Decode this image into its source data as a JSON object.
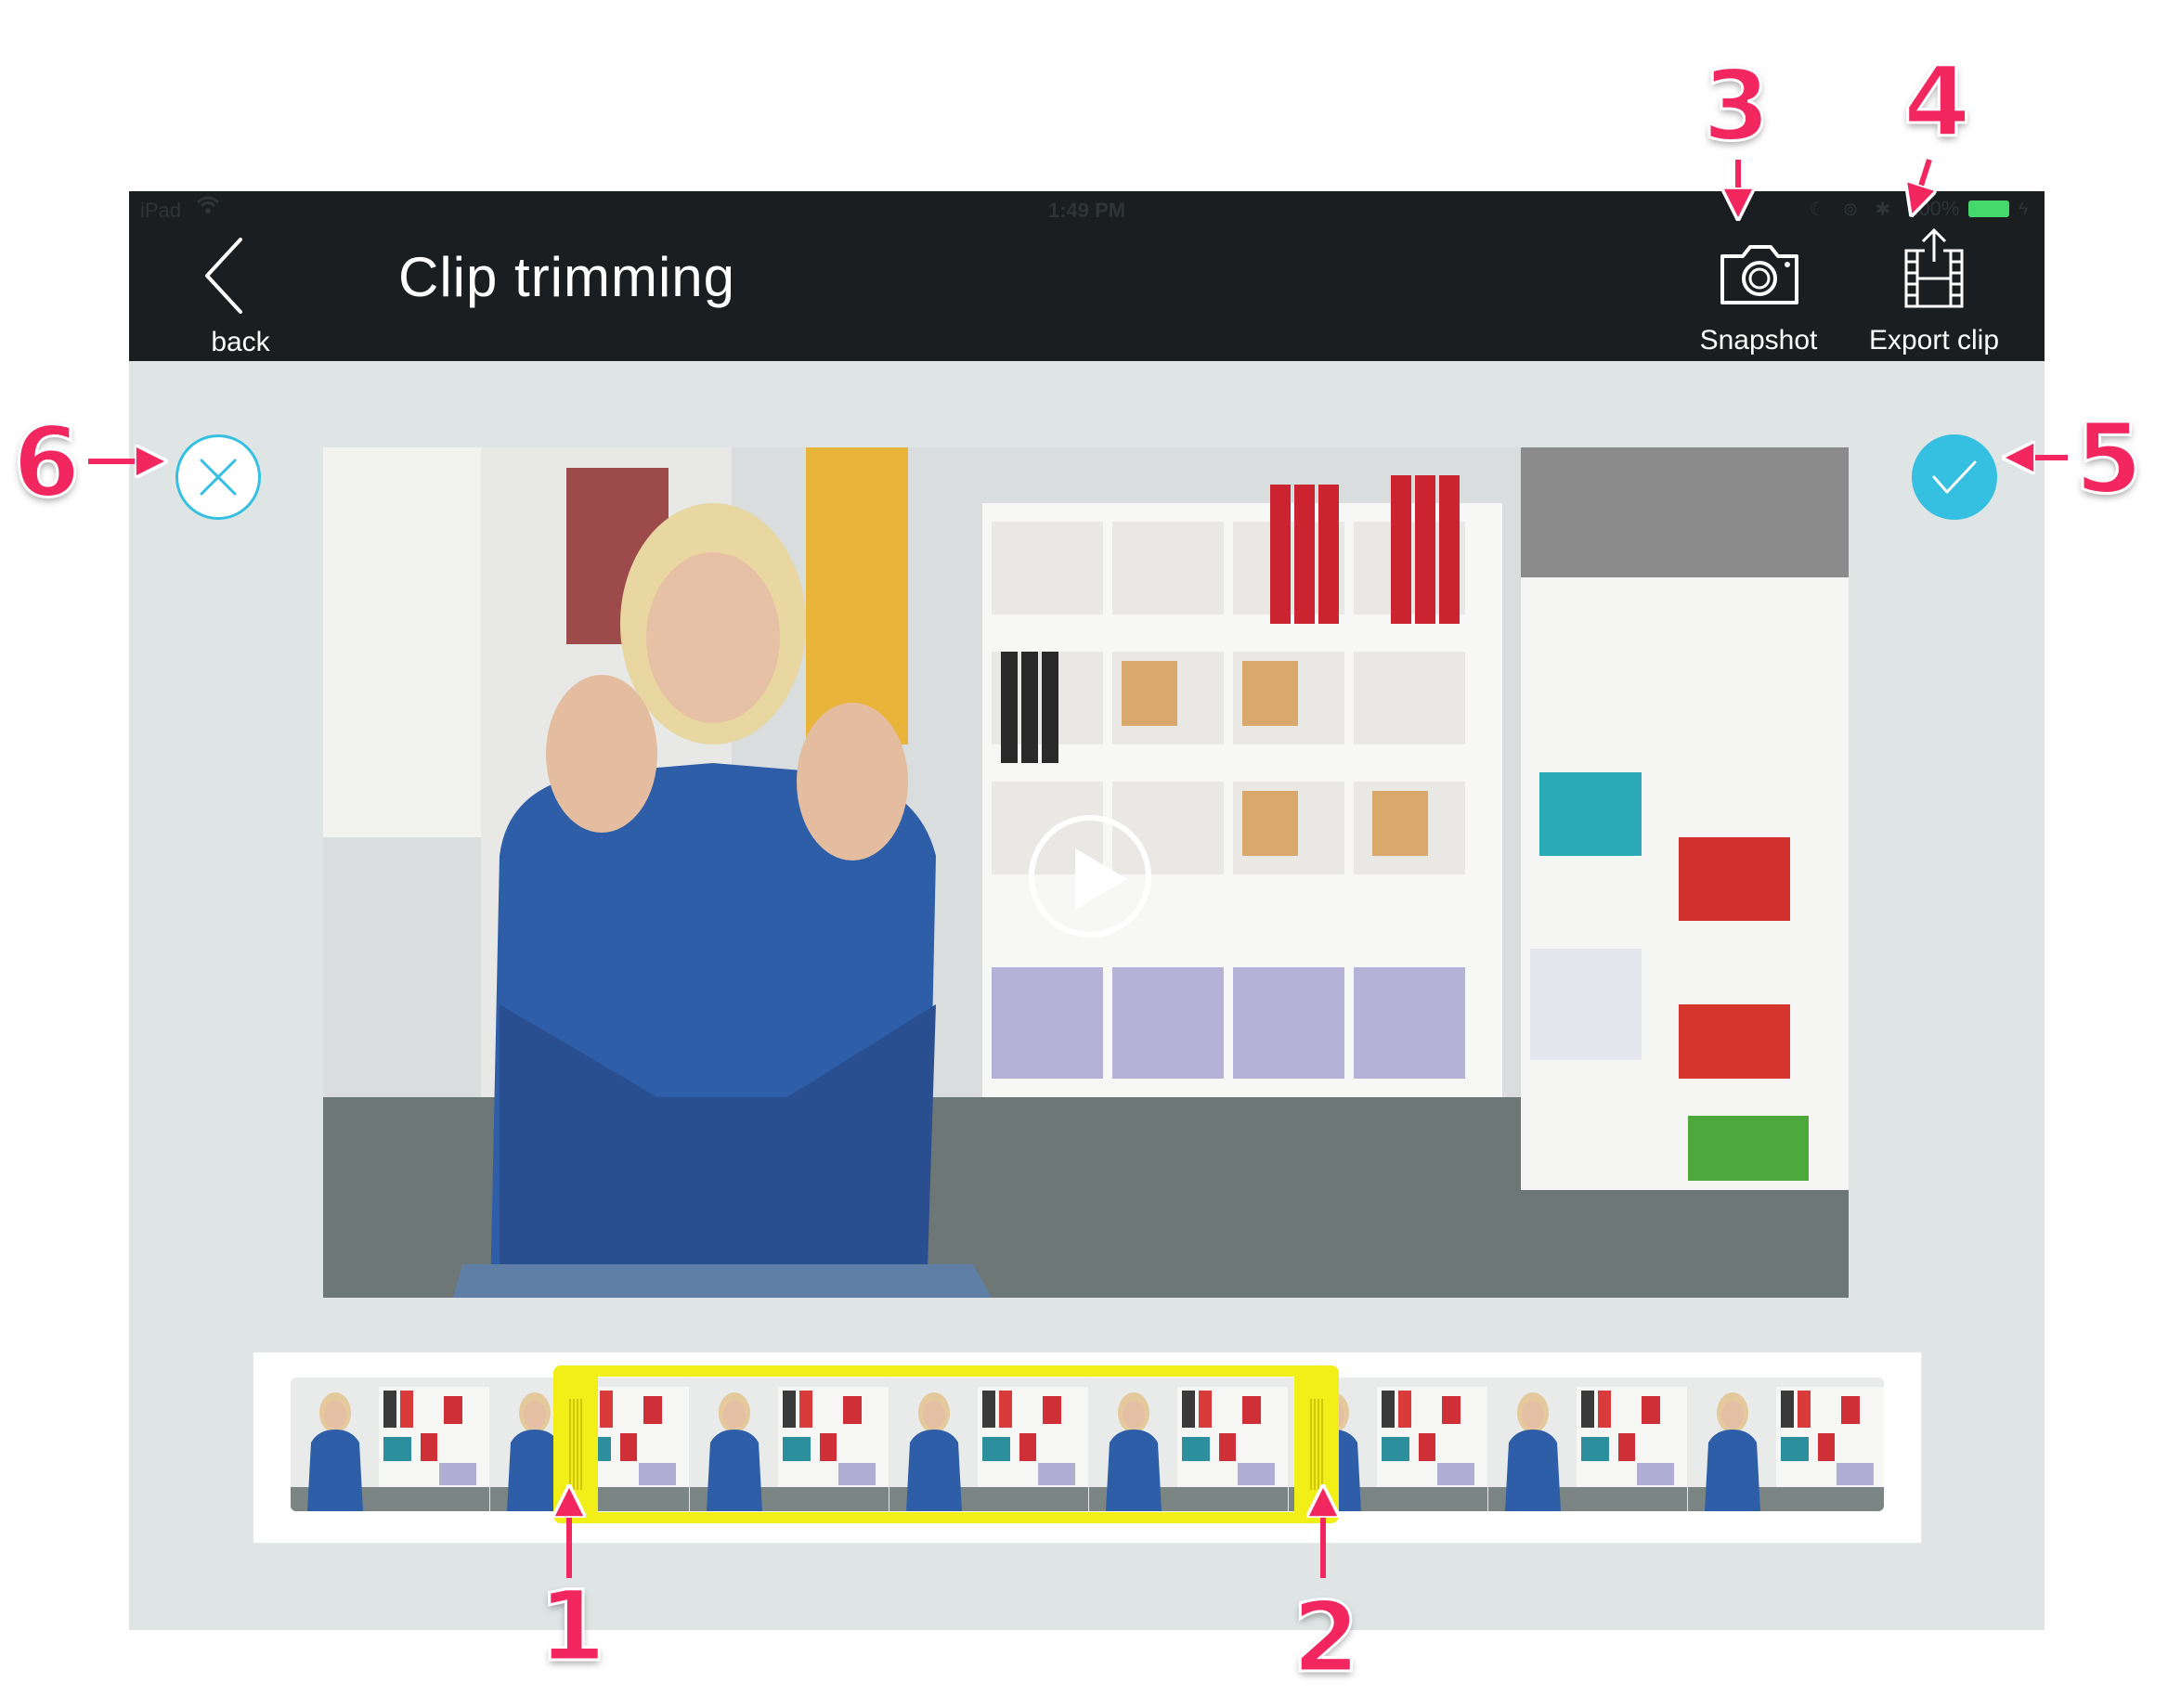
{
  "status_bar": {
    "carrier": "iPad",
    "time": "1:49 PM",
    "battery": "100%"
  },
  "nav": {
    "back_label": "back",
    "title": "Clip trimming",
    "snapshot_label": "Snapshot",
    "export_label": "Export clip"
  },
  "icons": {
    "back": "chevron-left-icon",
    "snapshot": "camera-icon",
    "export": "export-film-icon",
    "cancel": "close-icon",
    "confirm": "checkmark-icon",
    "play": "play-icon"
  },
  "timeline": {
    "frame_count": 8
  },
  "annotations": [
    "1",
    "2",
    "3",
    "4",
    "5",
    "6"
  ],
  "colors": {
    "navbar": "#1b1e20",
    "background": "#dfe5e5",
    "accent": "#35bfe0",
    "selection": "#f2ee18",
    "annotation": "#f2275f",
    "battery": "#45d96b"
  }
}
